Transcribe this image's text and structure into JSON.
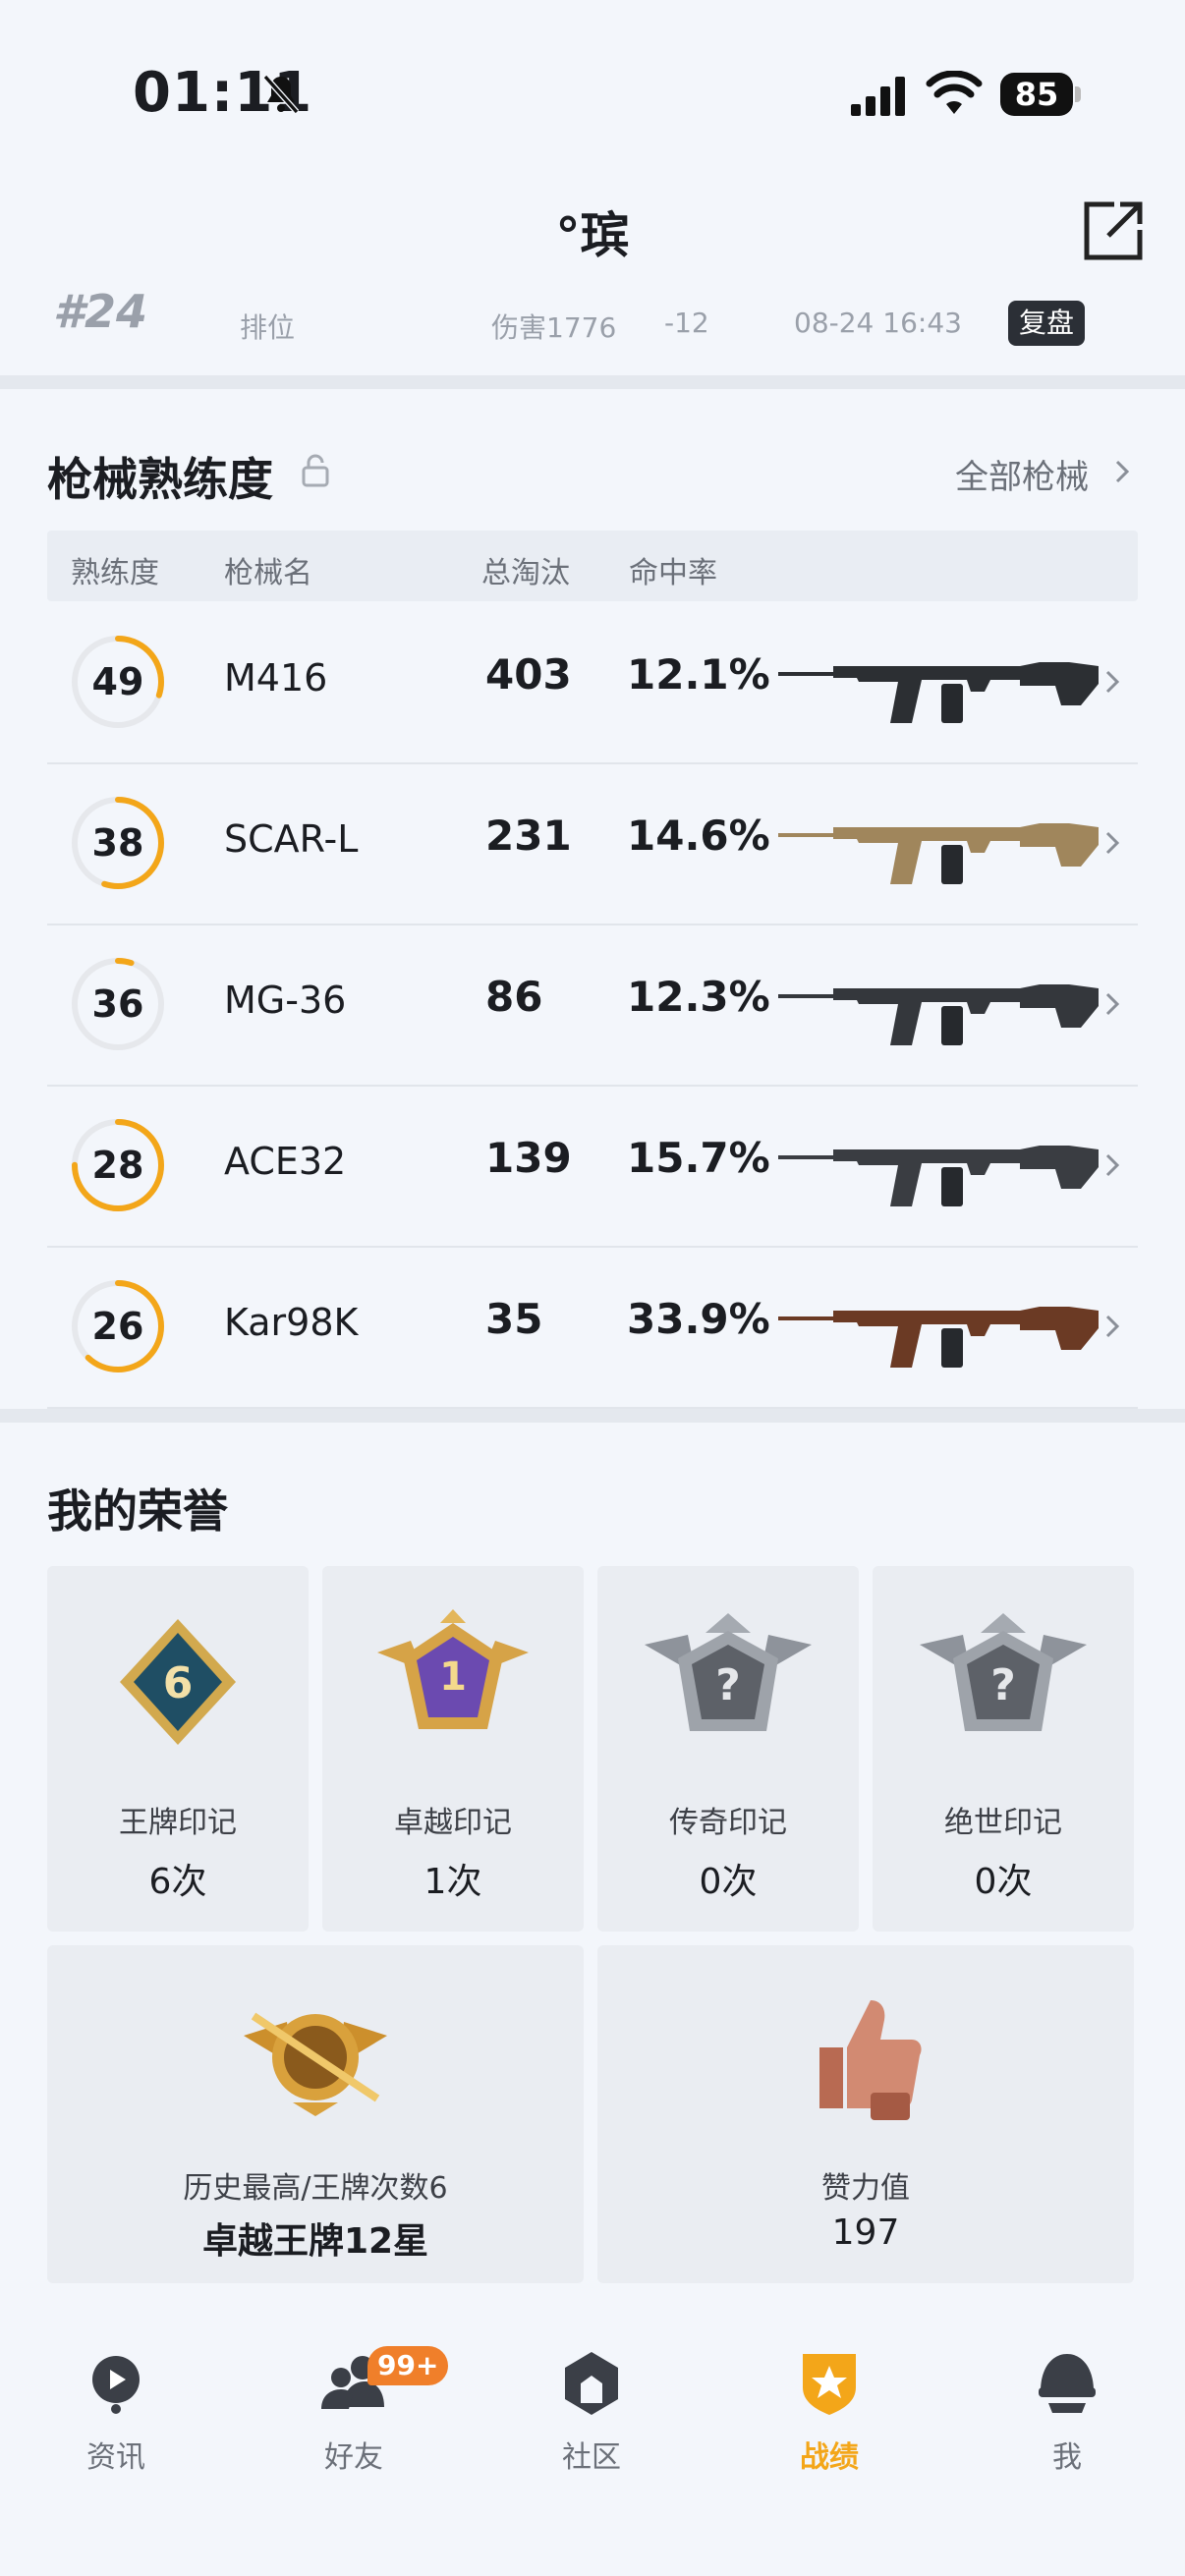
{
  "status_bar": {
    "time": "01:11",
    "battery": "85"
  },
  "header": {
    "nickname": "°瑸"
  },
  "match": {
    "rank": "#24",
    "mode": "排位",
    "damage": "伤害1776",
    "score": "-12",
    "time": "08-24 16:43",
    "replay": "复盘"
  },
  "weapons": {
    "title": "枪械熟练度",
    "all_link": "全部枪械",
    "columns": {
      "proficiency": "熟练度",
      "name": "枪械名",
      "kills": "总淘汰",
      "accuracy": "命中率"
    },
    "rows": [
      {
        "level": "49",
        "name": "M416",
        "kills": "403",
        "accuracy": "12.1%",
        "progress": 0.3
      },
      {
        "level": "38",
        "name": "SCAR-L",
        "kills": "231",
        "accuracy": "14.6%",
        "progress": 0.55
      },
      {
        "level": "36",
        "name": "MG-36",
        "kills": "86",
        "accuracy": "12.3%",
        "progress": 0.05
      },
      {
        "level": "28",
        "name": "ACE32",
        "kills": "139",
        "accuracy": "15.7%",
        "progress": 0.75
      },
      {
        "level": "26",
        "name": "Kar98K",
        "kills": "35",
        "accuracy": "33.9%",
        "progress": 0.62
      }
    ]
  },
  "honors": {
    "title": "我的荣誉",
    "marks": [
      {
        "label": "王牌印记",
        "value": "6次",
        "icon": "ace-mark-icon"
      },
      {
        "label": "卓越印记",
        "value": "1次",
        "icon": "excellence-mark-icon"
      },
      {
        "label": "传奇印记",
        "value": "0次",
        "icon": "legend-mark-icon"
      },
      {
        "label": "绝世印记",
        "value": "0次",
        "icon": "peerless-mark-icon"
      }
    ],
    "highest": {
      "label": "历史最高/王牌次数6",
      "value": "卓越王牌12星"
    },
    "likes": {
      "label": "赞力值",
      "value": "197"
    }
  },
  "nav": {
    "items": [
      {
        "label": "资讯",
        "icon": "news-icon"
      },
      {
        "label": "好友",
        "icon": "friends-icon"
      },
      {
        "label": "社区",
        "icon": "community-icon"
      },
      {
        "label": "战绩",
        "icon": "record-icon"
      },
      {
        "label": "我",
        "icon": "profile-icon"
      }
    ],
    "friends_badge": "99+"
  },
  "colors": {
    "accent": "#f3a619",
    "ring_track": "#e6e8ec",
    "badge": "#f07f2a"
  }
}
